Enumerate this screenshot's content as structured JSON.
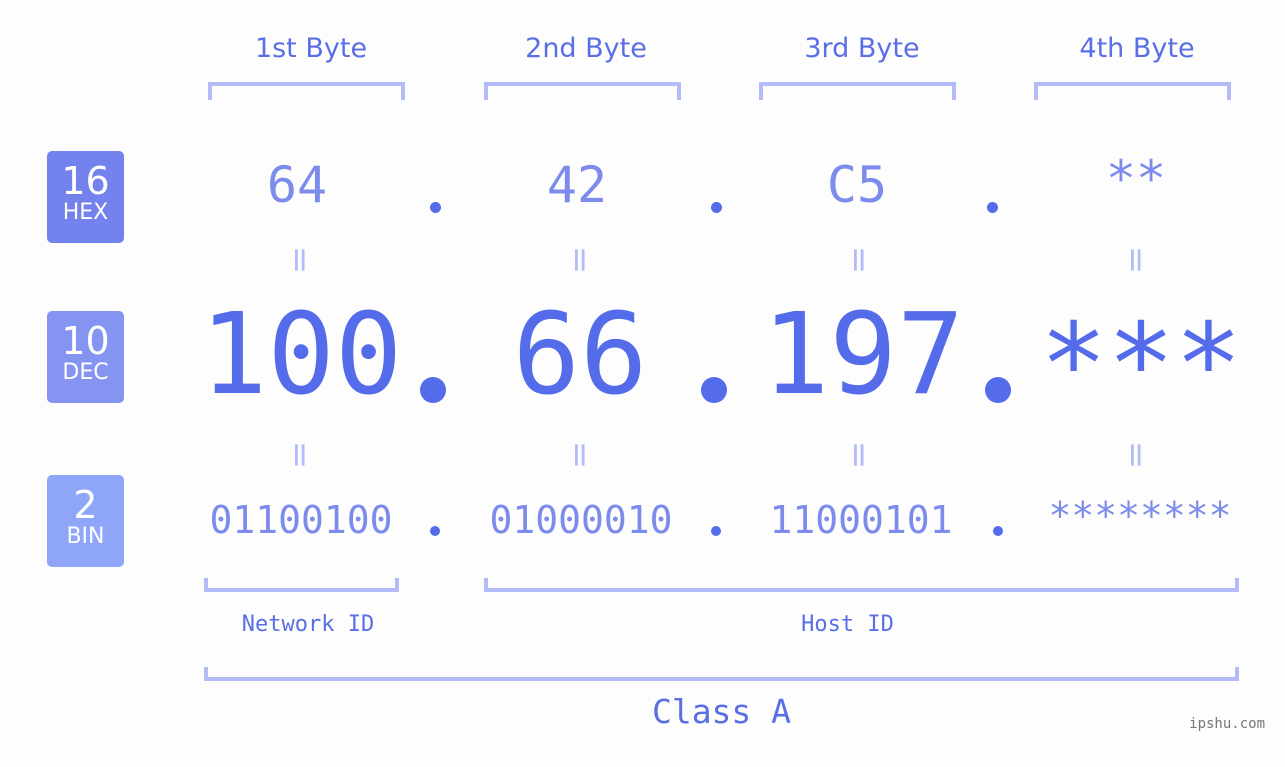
{
  "bytes": [
    {
      "header": "1st Byte",
      "hex": "64",
      "dec": "100",
      "bin": "01100100"
    },
    {
      "header": "2nd Byte",
      "hex": "42",
      "dec": "66",
      "bin": "01000010"
    },
    {
      "header": "3rd Byte",
      "hex": "C5",
      "dec": "197",
      "bin": "11000101"
    },
    {
      "header": "4th Byte",
      "hex": "**",
      "dec": "***",
      "bin": "********"
    }
  ],
  "rows": {
    "hex": {
      "base": "16",
      "label": "HEX",
      "color": "#7382ec"
    },
    "dec": {
      "base": "10",
      "label": "DEC",
      "color": "#8594f1"
    },
    "bin": {
      "base": "2",
      "label": "BIN",
      "color": "#8ea5f8"
    }
  },
  "equals_symbol": "=",
  "network_id": "Network ID",
  "host_id": "Host ID",
  "class_label": "Class A",
  "watermark": "ipshu.com",
  "colors": {
    "accent": "#546bea",
    "light": "#7c8bec",
    "bracket": "#b4bcf7"
  }
}
